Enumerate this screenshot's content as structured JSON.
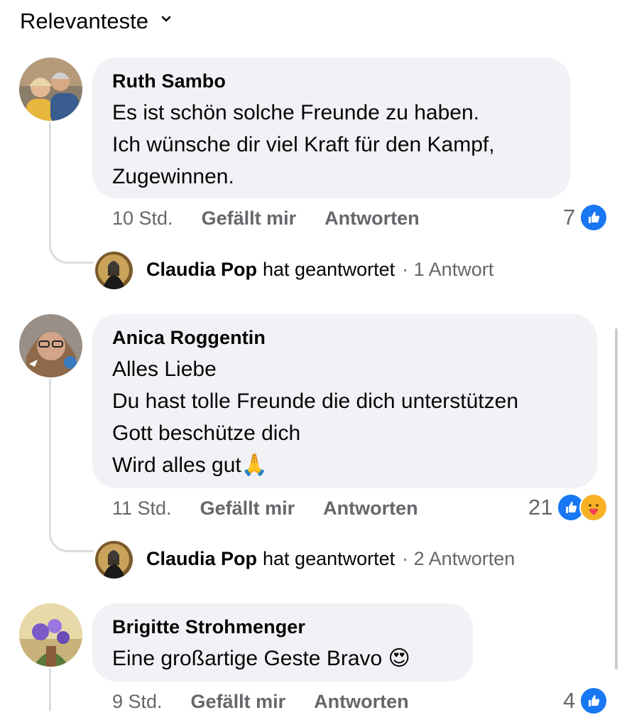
{
  "sort": {
    "label": "Relevanteste",
    "icon": "chevron-down-icon"
  },
  "comments": [
    {
      "author": "Ruth Sambo",
      "lines": [
        "Es ist schön solche Freunde zu haben.",
        "Ich wünsche dir viel Kraft für den Kampf,",
        "Zugewinnen."
      ],
      "time": "10 Std.",
      "like_label": "Gefällt mir",
      "reply_label": "Antworten",
      "reaction_count": "7",
      "reactions": [
        "like-icon"
      ],
      "reply_summary": {
        "name": "Claudia Pop",
        "verb": "hat geantwortet",
        "count": "· 1 Antwort"
      }
    },
    {
      "author": "Anica Roggentin",
      "lines": [
        "Alles Liebe",
        "Du hast tolle Freunde die dich unterstützen",
        "Gott beschütze dich",
        "Wird alles gut🙏"
      ],
      "time": "11 Std.",
      "like_label": "Gefällt mir",
      "reply_label": "Antworten",
      "reaction_count": "21",
      "reactions": [
        "like-icon",
        "care-icon"
      ],
      "reply_summary": {
        "name": "Claudia Pop",
        "verb": "hat geantwortet",
        "count": "· 2 Antworten"
      }
    },
    {
      "author": "Brigitte Strohmenger",
      "lines": [
        "Eine großartige Geste Bravo 😍"
      ],
      "time": "9 Std.",
      "like_label": "Gefällt mir",
      "reply_label": "Antworten",
      "reaction_count": "4",
      "reactions": [
        "like-icon"
      ]
    }
  ],
  "colors": {
    "bubble": "#f0f2f5",
    "meta": "#65676b",
    "like": "#1877f2",
    "thread_line": "#dadde1"
  }
}
